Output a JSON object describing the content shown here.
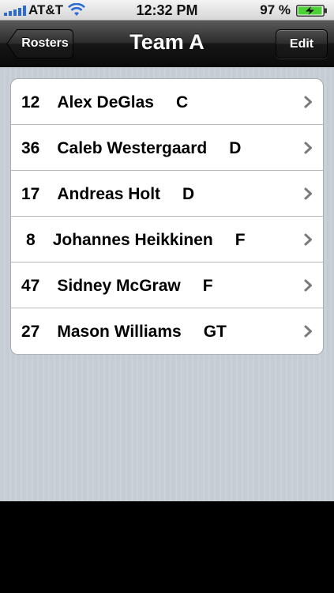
{
  "status_bar": {
    "carrier": "AT&T",
    "time": "12:32 PM",
    "battery_percent": "97 %",
    "battery_level": 0.97
  },
  "nav": {
    "title": "Team A",
    "back_label": "Rosters",
    "edit_label": "Edit"
  },
  "roster": [
    {
      "number": "12",
      "name": "Alex DeGlas",
      "position": "C"
    },
    {
      "number": "36",
      "name": "Caleb Westergaard",
      "position": "D"
    },
    {
      "number": "17",
      "name": "Andreas Holt",
      "position": "D"
    },
    {
      "number": "8",
      "name": "Johannes Heikkinen",
      "position": "F"
    },
    {
      "number": "47",
      "name": "Sidney McGraw",
      "position": "F"
    },
    {
      "number": "27",
      "name": "Mason Williams",
      "position": "GT"
    }
  ],
  "colors": {
    "background_pinstripe": "#c5ccd4",
    "nav_bar": "#1a1a1a",
    "battery_fill": "#4cd137"
  }
}
